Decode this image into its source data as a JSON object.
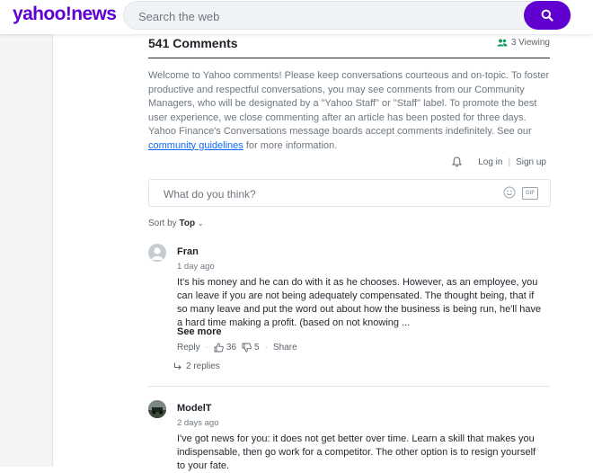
{
  "header": {
    "logo": "yahoo!news",
    "search_placeholder": "Search the web"
  },
  "comments_header": {
    "count": "541 Comments",
    "viewing": "3 Viewing"
  },
  "welcome": {
    "text": "Welcome to Yahoo comments! Please keep conversations courteous and on-topic. To foster productive and respectful conversations, you may see comments from our Community Managers, who will be designated by a \"Yahoo Staff\" or \"Staff\" label. To promote the best user experience, we close commenting after an article has been posted for three days. Yahoo Finance's Conversations message boards accept comments indefinitely. See our",
    "link": "community guidelines",
    "after": "for more information."
  },
  "auth": {
    "login": "Log in",
    "separator": "|",
    "signup": "Sign up"
  },
  "composer": {
    "placeholder": "What do you think?",
    "gif": "GIF"
  },
  "sort": {
    "label": "Sort by",
    "value": "Top"
  },
  "comments": [
    {
      "author": "Fran",
      "ago": "1 day ago",
      "body": "It's his money and he can do with it as he chooses.  However, as an employee, you can leave if you are not being adequately compensated.  The thought being, that if so many leave and put the word out about how the business is being run, he'll have a hard time making a profit. (based on not knowing ...",
      "see_more": "See more",
      "reply": "Reply",
      "upvotes": "36",
      "downvotes": "5",
      "share": "Share",
      "replies": "2 replies"
    },
    {
      "author": "ModelT",
      "ago": "2 days ago",
      "body": "I've got news for you: it does not get better over time. Learn a skill that makes you indispensable, then go work for a competitor. The other option is to resign yourself to your fate."
    }
  ],
  "colors": {
    "brand": "#6001d2",
    "link": "#0f69ff",
    "muted": "#6e7780"
  }
}
